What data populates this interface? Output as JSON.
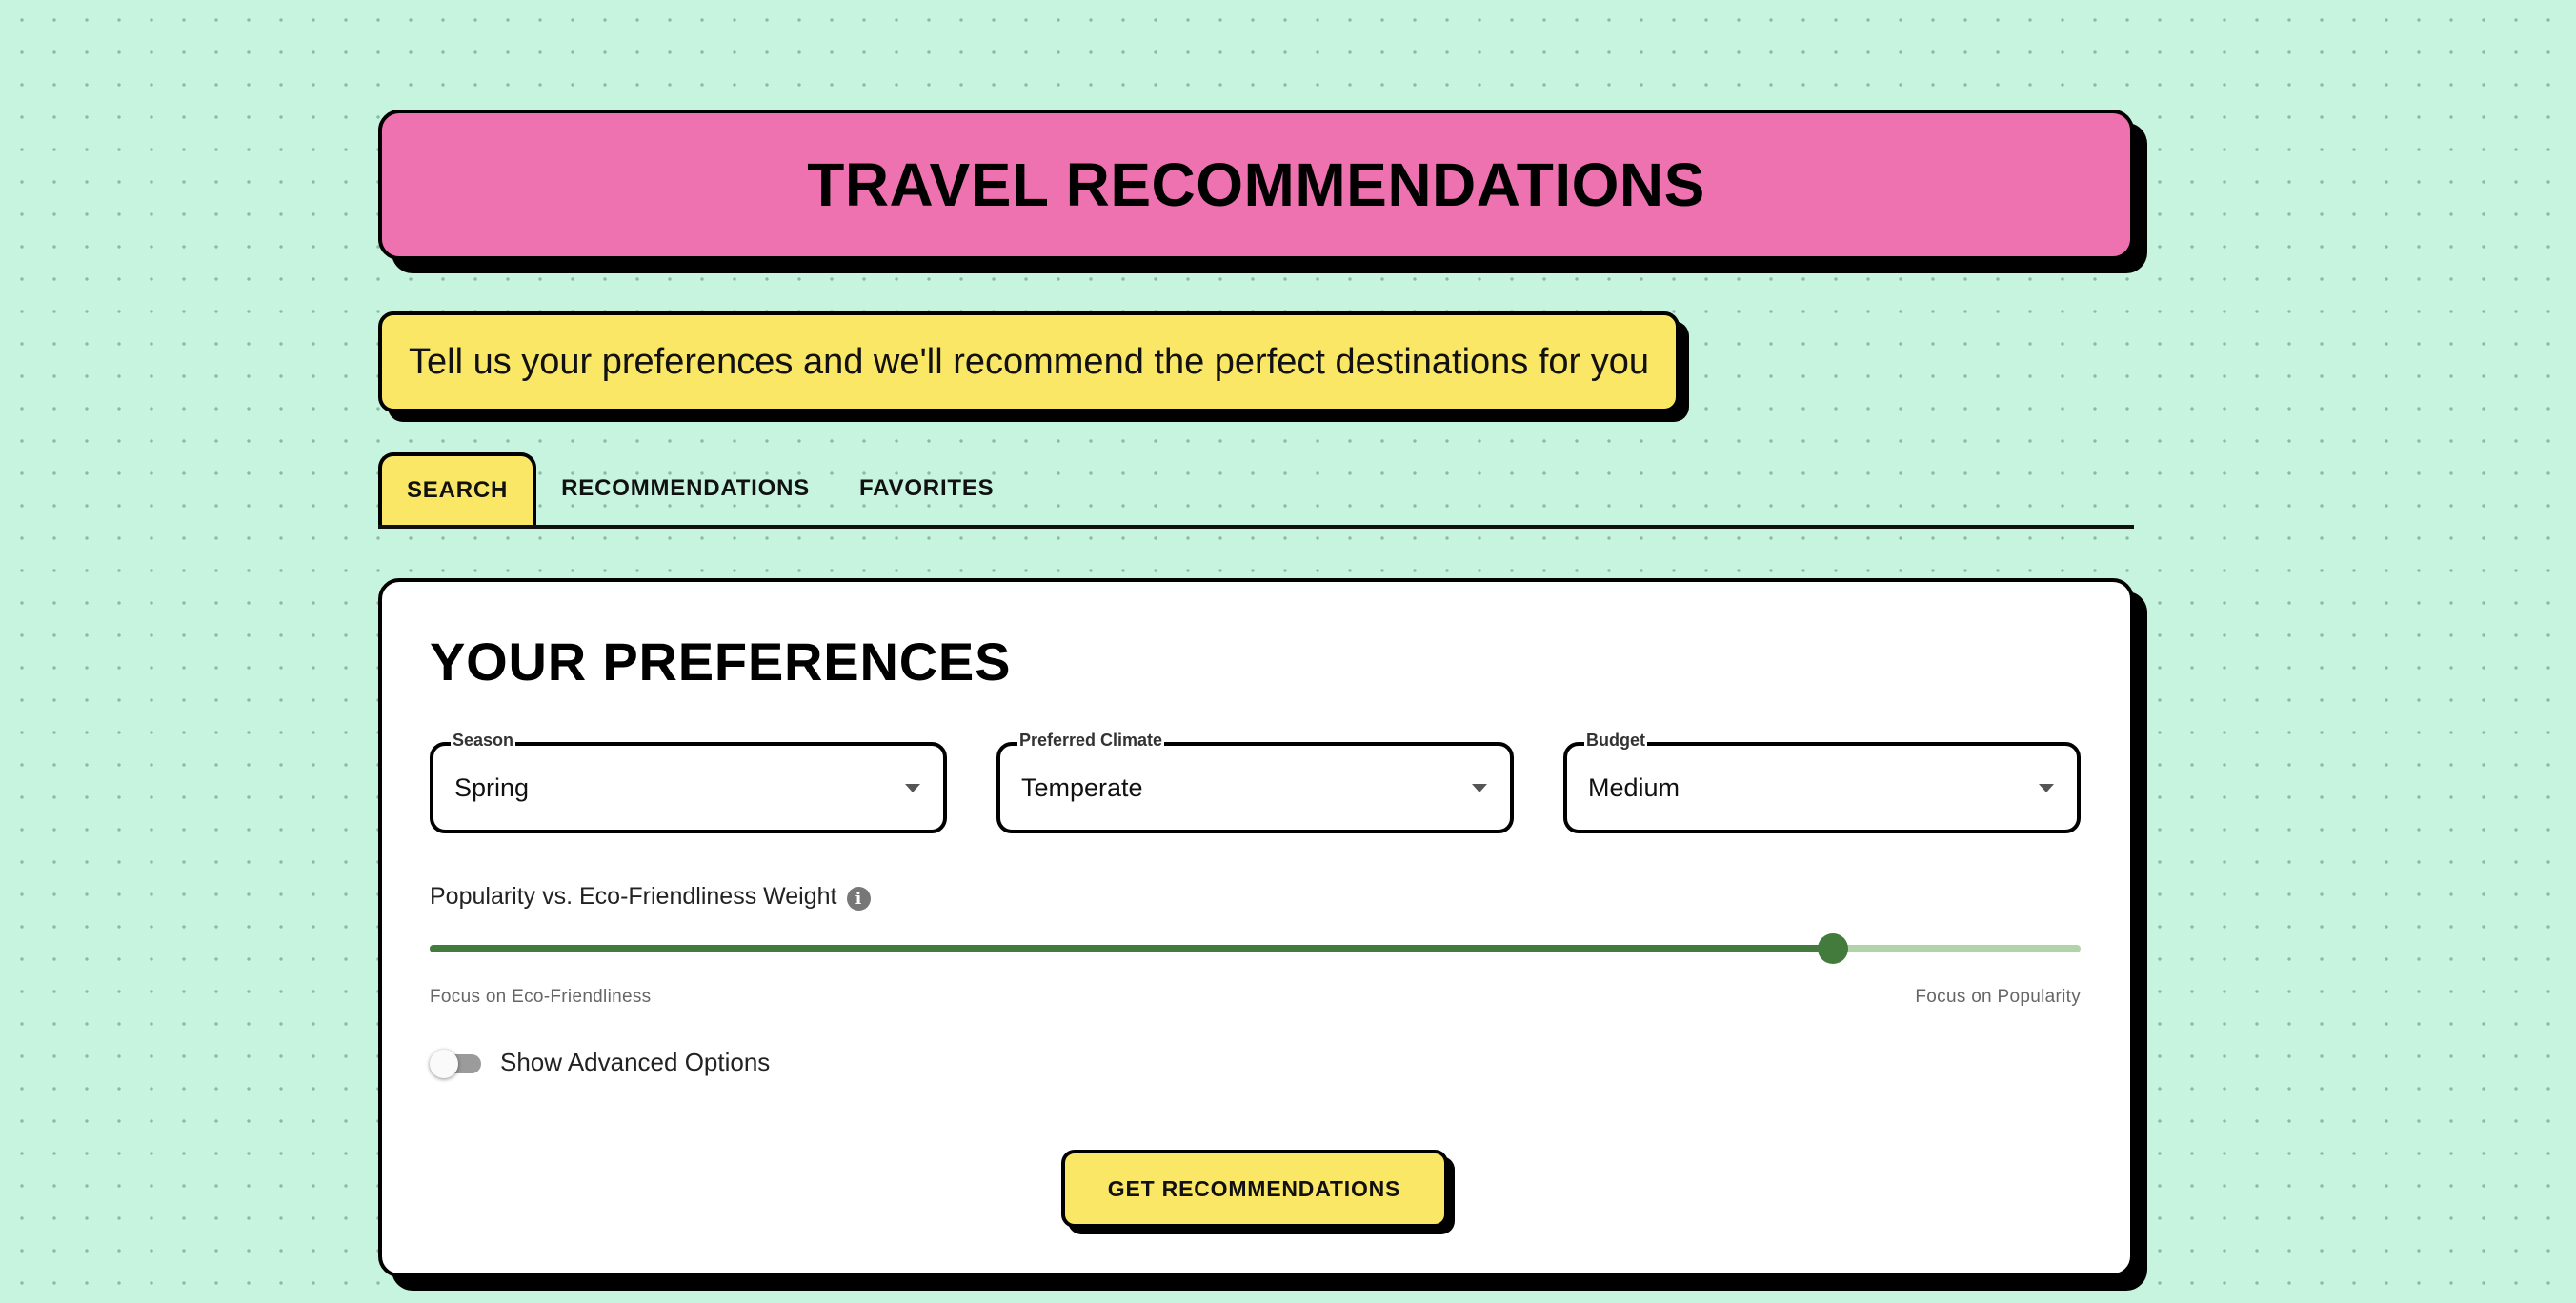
{
  "header": {
    "title": "TRAVEL RECOMMENDATIONS",
    "subtitle": "Tell us your preferences and we'll recommend the perfect destinations for you"
  },
  "tabs": [
    {
      "label": "SEARCH",
      "active": true
    },
    {
      "label": "RECOMMENDATIONS",
      "active": false
    },
    {
      "label": "FAVORITES",
      "active": false
    }
  ],
  "preferences": {
    "title": "YOUR PREFERENCES",
    "selects": [
      {
        "label": "Season",
        "value": "Spring"
      },
      {
        "label": "Preferred Climate",
        "value": "Temperate"
      },
      {
        "label": "Budget",
        "value": "Medium"
      }
    ],
    "slider": {
      "label": "Popularity vs. Eco-Friendliness Weight",
      "info_icon": "info-icon",
      "value_fraction": 0.85,
      "min_label": "Focus on Eco-Friendliness",
      "max_label": "Focus on Popularity"
    },
    "toggle": {
      "label": "Show Advanced Options",
      "checked": false
    },
    "submit_label": "GET RECOMMENDATIONS"
  },
  "colors": {
    "background": "#c6f4df",
    "header_pink": "#ee72b0",
    "accent_yellow": "#fae766",
    "slider_green": "#437b3c",
    "slider_rail": "#b2d3a8"
  }
}
